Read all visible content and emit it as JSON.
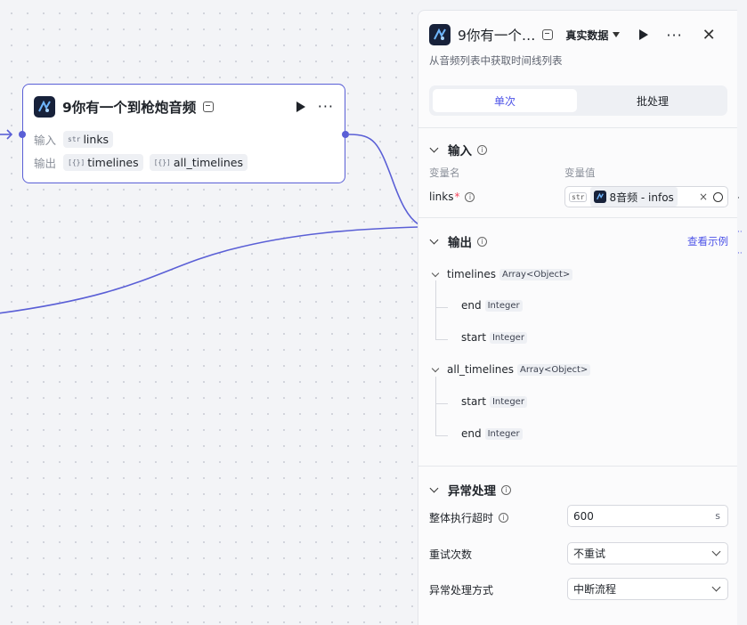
{
  "node": {
    "title": "9你有一个到枪炮音频",
    "input_label": "输入",
    "output_label": "输出",
    "inputs": [
      {
        "type": "str",
        "name": "links"
      }
    ],
    "outputs": [
      {
        "type": "[{}]",
        "name": "timelines"
      },
      {
        "type": "[{}]",
        "name": "all_timelines"
      }
    ]
  },
  "panel": {
    "title": "9你有一个…",
    "data_mode": "真实数据",
    "description": "从音频列表中获取时间线列表",
    "tabs": {
      "single": "单次",
      "batch": "批处理"
    },
    "input_section": {
      "title": "输入",
      "col_name": "变量名",
      "col_value": "变量值",
      "param_name": "links",
      "required_mark": "*",
      "type_tag": "str",
      "ref_value": "8音频 - infos",
      "clear": "×"
    },
    "output_section": {
      "title": "输出",
      "example_link": "查看示例",
      "tree": [
        {
          "name": "timelines",
          "type": "Array<Object>",
          "children": [
            {
              "name": "end",
              "type": "Integer"
            },
            {
              "name": "start",
              "type": "Integer"
            }
          ]
        },
        {
          "name": "all_timelines",
          "type": "Array<Object>",
          "children": [
            {
              "name": "start",
              "type": "Integer"
            },
            {
              "name": "end",
              "type": "Integer"
            }
          ]
        }
      ]
    },
    "exception_section": {
      "title": "异常处理",
      "timeout_label": "整体执行超时",
      "timeout_value": "600",
      "timeout_unit": "s",
      "retry_label": "重试次数",
      "retry_value": "不重试",
      "method_label": "异常处理方式",
      "method_value": "中断流程"
    }
  },
  "colors": {
    "accent": "#5a5fd6",
    "link": "#4d53e8"
  }
}
